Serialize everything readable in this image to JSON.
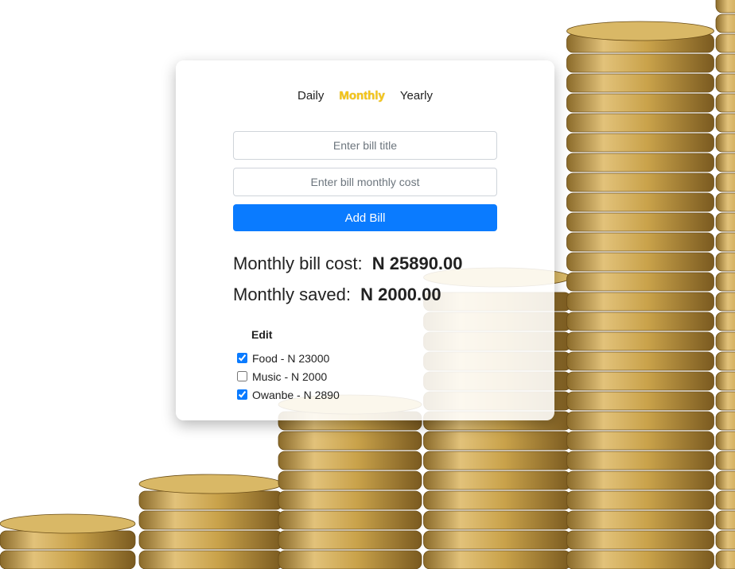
{
  "tabs": [
    {
      "label": "Daily",
      "active": false
    },
    {
      "label": "Monthly",
      "active": true
    },
    {
      "label": "Yearly",
      "active": false
    }
  ],
  "form": {
    "title_placeholder": "Enter bill title",
    "title_value": "",
    "cost_placeholder": "Enter bill monthly cost",
    "cost_value": "",
    "add_label": "Add Bill"
  },
  "summary": {
    "cost_label": "Monthly bill cost:",
    "cost_value": "N 25890.00",
    "saved_label": "Monthly saved:",
    "saved_value": "N 2000.00"
  },
  "bills": {
    "edit_label": "Edit",
    "items": [
      {
        "label": "Food - N 23000",
        "checked": true
      },
      {
        "label": "Music - N 2000",
        "checked": false
      },
      {
        "label": "Owanbe - N 2890",
        "checked": true
      }
    ]
  },
  "colors": {
    "accent": "#0a7bff",
    "active_tab": "#f5c518",
    "coin": "#c9a24a"
  }
}
